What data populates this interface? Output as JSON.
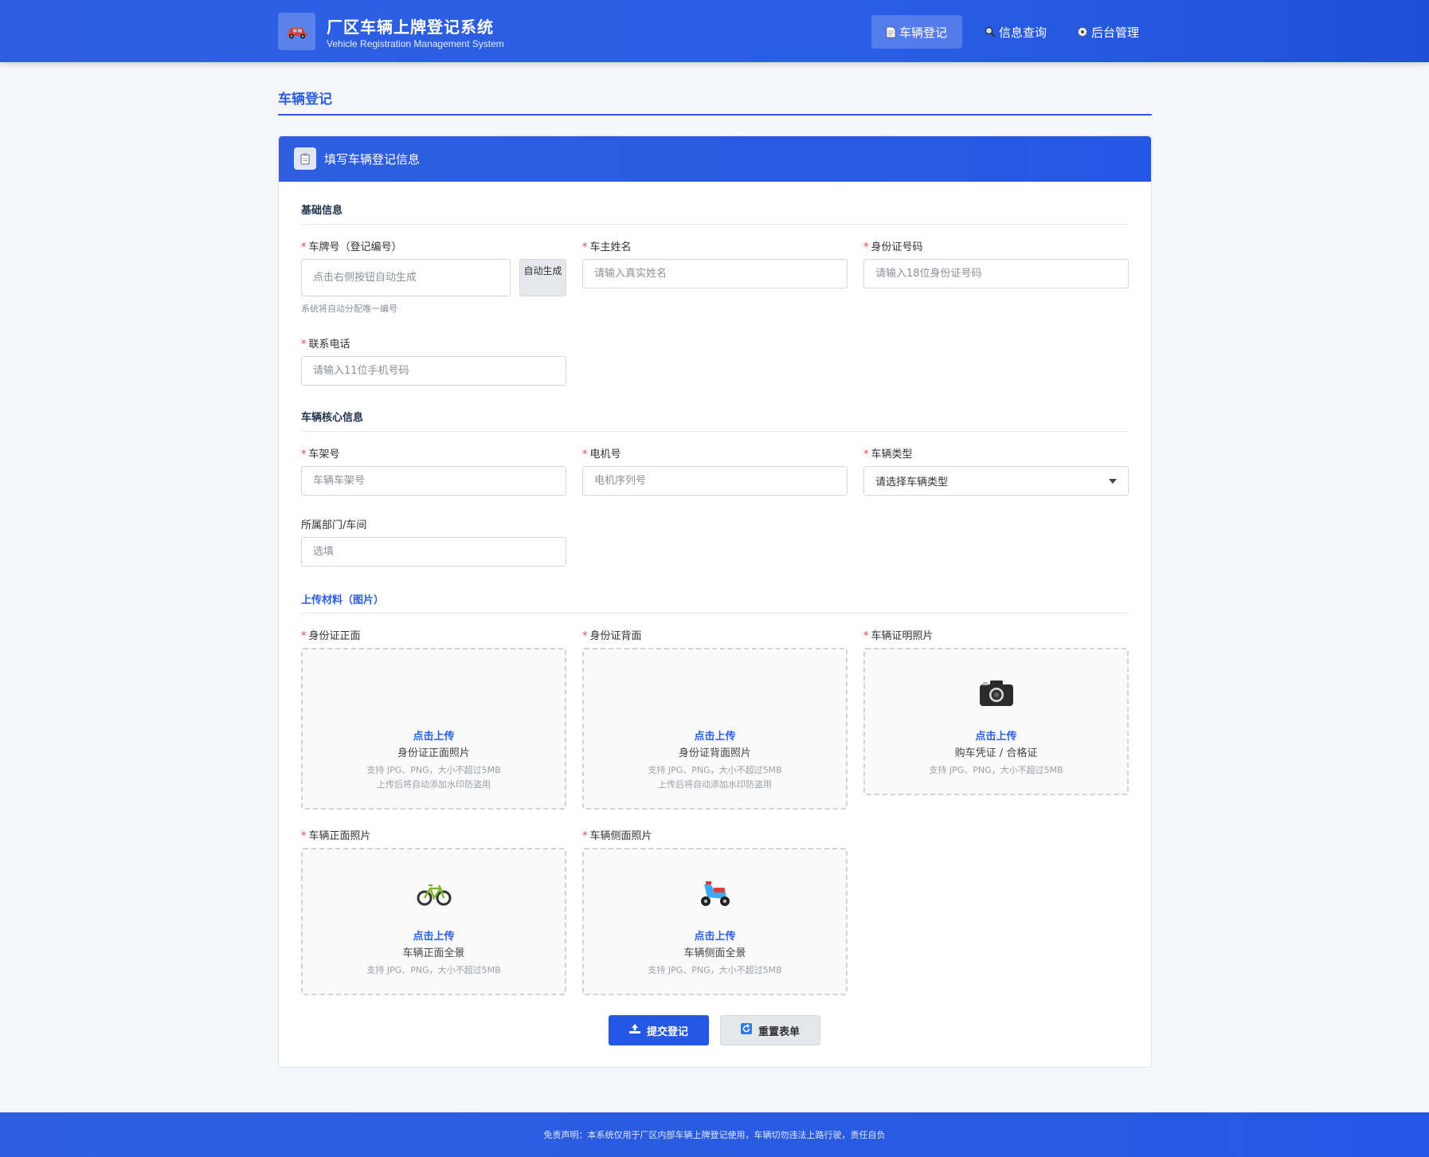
{
  "header": {
    "title": "厂区车辆上牌登记系统",
    "subtitle": "Vehicle Registration Management System",
    "logo_icon": "car-icon",
    "nav": [
      {
        "label": "车辆登记",
        "icon": "document-icon",
        "active": true
      },
      {
        "label": "信息查询",
        "icon": "magnifier-icon",
        "active": false
      },
      {
        "label": "后台管理",
        "icon": "gear-icon",
        "active": false
      }
    ]
  },
  "page": {
    "title": "车辆登记"
  },
  "card": {
    "title": "填写车辆登记信息",
    "icon": "clipboard-icon"
  },
  "sections": {
    "basic": "基础信息",
    "core": "车辆核心信息",
    "upload": "上传材料（图片）"
  },
  "fields": {
    "plate": {
      "label": "车牌号（登记编号）",
      "placeholder": "点击右侧按钮自动生成",
      "hint": "系统将自动分配唯一编号",
      "button": "自动生成"
    },
    "owner": {
      "label": "车主姓名",
      "placeholder": "请输入真实姓名"
    },
    "idnum": {
      "label": "身份证号码",
      "placeholder": "请输入18位身份证号码"
    },
    "phone": {
      "label": "联系电话",
      "placeholder": "请输入11位手机号码"
    },
    "frame": {
      "label": "车架号",
      "placeholder": "车辆车架号"
    },
    "motor": {
      "label": "电机号",
      "placeholder": "电机序列号"
    },
    "vtype": {
      "label": "车辆类型",
      "value": "请选择车辆类型"
    },
    "dept": {
      "label": "所属部门/车间",
      "placeholder": "选填"
    }
  },
  "uploads": {
    "id_front": {
      "label": "身份证正面",
      "link": "点击上传",
      "desc": "身份证正面照片",
      "note1": "支持 JPG、PNG，大小不超过5MB",
      "note2": "上传后将自动添加水印防盗用"
    },
    "id_back": {
      "label": "身份证背面",
      "link": "点击上传",
      "desc": "身份证背面照片",
      "note1": "支持 JPG、PNG，大小不超过5MB",
      "note2": "上传后将自动添加水印防盗用"
    },
    "proof": {
      "label": "车辆证明照片",
      "icon": "camera-icon",
      "link": "点击上传",
      "desc": "购车凭证 / 合格证",
      "note1": "支持 JPG、PNG，大小不超过5MB"
    },
    "front": {
      "label": "车辆正面照片",
      "icon": "bicycle-icon",
      "link": "点击上传",
      "desc": "车辆正面全景",
      "note1": "支持 JPG、PNG，大小不超过5MB"
    },
    "side": {
      "label": "车辆侧面照片",
      "icon": "scooter-icon",
      "link": "点击上传",
      "desc": "车辆侧面全景",
      "note1": "支持 JPG、PNG，大小不超过5MB"
    }
  },
  "actions": {
    "submit": "提交登记",
    "reset": "重置表单"
  },
  "footer": {
    "text": "免责声明：本系统仅用于厂区内部车辆上牌登记使用，车辆切勿违法上路行驶，责任自负"
  },
  "colors": {
    "primary": "#2a5ee6",
    "required": "#e5484d"
  }
}
